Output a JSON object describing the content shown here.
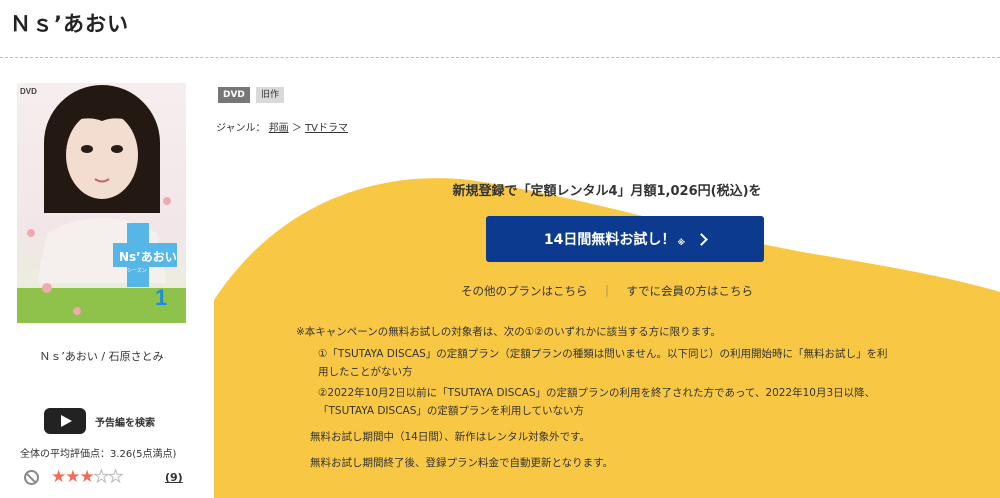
{
  "title": "Ｎｓ’あおい",
  "cover": {
    "dvd_mark": "DVD",
    "logo_text": "Ns’あおい",
    "logo_sub": "シーズン",
    "volume": "1"
  },
  "item_caption": "Ｎｓ’あおい / 石原さとみ",
  "trailer_label": "予告編を検索",
  "rating": {
    "avg_label": "全体の平均評価点：",
    "avg_value": "3.26(5点満点)",
    "stars": 3,
    "stars_max": 5,
    "review_count": "(9)"
  },
  "badges": {
    "dvd": "DVD",
    "old": "旧作"
  },
  "genre": {
    "label": "ジャンル：",
    "item1": "邦画",
    "sep": "＞",
    "item2": "TVドラマ"
  },
  "promo": {
    "headline": "新規登録で「定額レンタル4」月額1,026円(税込)を",
    "cta_label": "14日間無料お試し！",
    "cta_mark": "※",
    "link_other": "その他のプランはこちら",
    "link_sep": "｜",
    "link_member": "すでに会員の方はこちら"
  },
  "notes": {
    "main": "※本キャンペーンの無料お試しの対象者は、次の①②のいずれかに該当する方に限ります。",
    "cond1_a": "①「TSUTAYA DISCAS」の定額プラン（定額プランの種類は問いません。以下同じ）の利用開始時に「無料お試し」を利",
    "cond1_b": "用したことがない方",
    "cond2_a": "②2022年10月2日以前に「TSUTAYA DISCAS」の定額プランの利用を終了された方であって、2022年10月3日以降、",
    "cond2_b": "「TSUTAYA DISCAS」の定額プランを利用していない方",
    "trial": "無料お試し期間中（14日間）、新作はレンタル対象外です。",
    "renew": "無料お試し期間終了後、登録プラン料金で自動更新となります。"
  },
  "colors": {
    "promo_bg": "#f8c844",
    "cta": "#0b3a8f",
    "star": "#f26b5b"
  }
}
